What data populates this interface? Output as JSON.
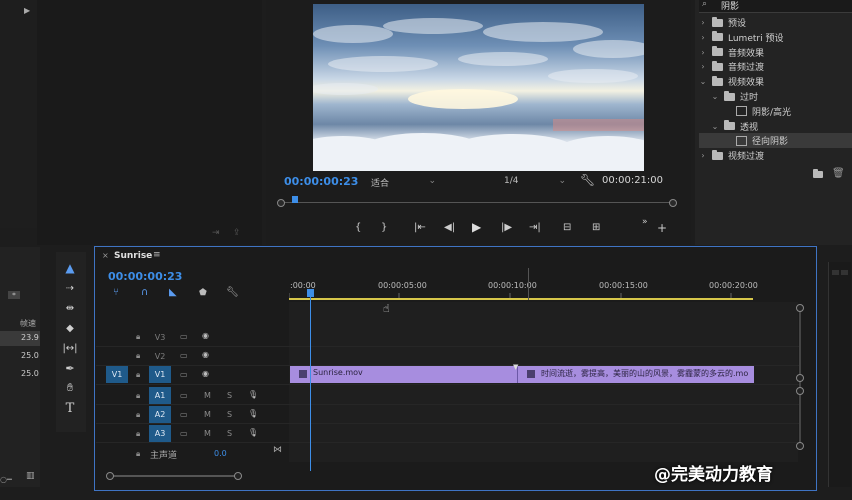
{
  "program_monitor": {
    "timecode_current": "00:00:00:23",
    "fit_label": "适合",
    "resolution": "1/4",
    "timecode_duration": "00:00:21:00"
  },
  "effects_panel": {
    "search_value": "阴影",
    "items": [
      {
        "label": "预设",
        "type": "folder"
      },
      {
        "label": "Lumetri 预设",
        "type": "folder"
      },
      {
        "label": "音频效果",
        "type": "folder"
      },
      {
        "label": "音频过渡",
        "type": "folder"
      },
      {
        "label": "视频效果",
        "type": "folder"
      },
      {
        "label": "过时",
        "type": "folder"
      },
      {
        "label": "阴影/高光",
        "type": "effect"
      },
      {
        "label": "透视",
        "type": "folder"
      },
      {
        "label": "径向阴影",
        "type": "effect"
      },
      {
        "label": "视频过渡",
        "type": "folder"
      }
    ]
  },
  "project_panel": {
    "column_header": "帧速",
    "rows": [
      "23.9",
      "25.0",
      "25.0"
    ]
  },
  "timeline": {
    "sequence_name": "Sunrise",
    "timecode": "00:00:00:23",
    "ruler_labels": [
      ":00:00",
      "00:00:05:00",
      "00:00:10:00",
      "00:00:15:00",
      "00:00:20:00"
    ],
    "tracks": {
      "v3": "V3",
      "v2": "V2",
      "v1": "V1",
      "v1_source": "V1",
      "a1": "A1",
      "a2": "A2",
      "a3": "A3",
      "mute": "M",
      "solo": "S",
      "master_label": "主声道",
      "master_value": "0.0"
    },
    "clips": {
      "clip1": "Sunrise.mov",
      "clip2": "时间流逝，雾提高，美丽的山的风景，雾霾蒙的多云的.mo"
    }
  },
  "watermark": "@完美动力教育",
  "colors": {
    "accent_blue": "#3d8ee8",
    "clip_purple": "#a78ddf",
    "work_area_yellow": "#d6c64a"
  }
}
